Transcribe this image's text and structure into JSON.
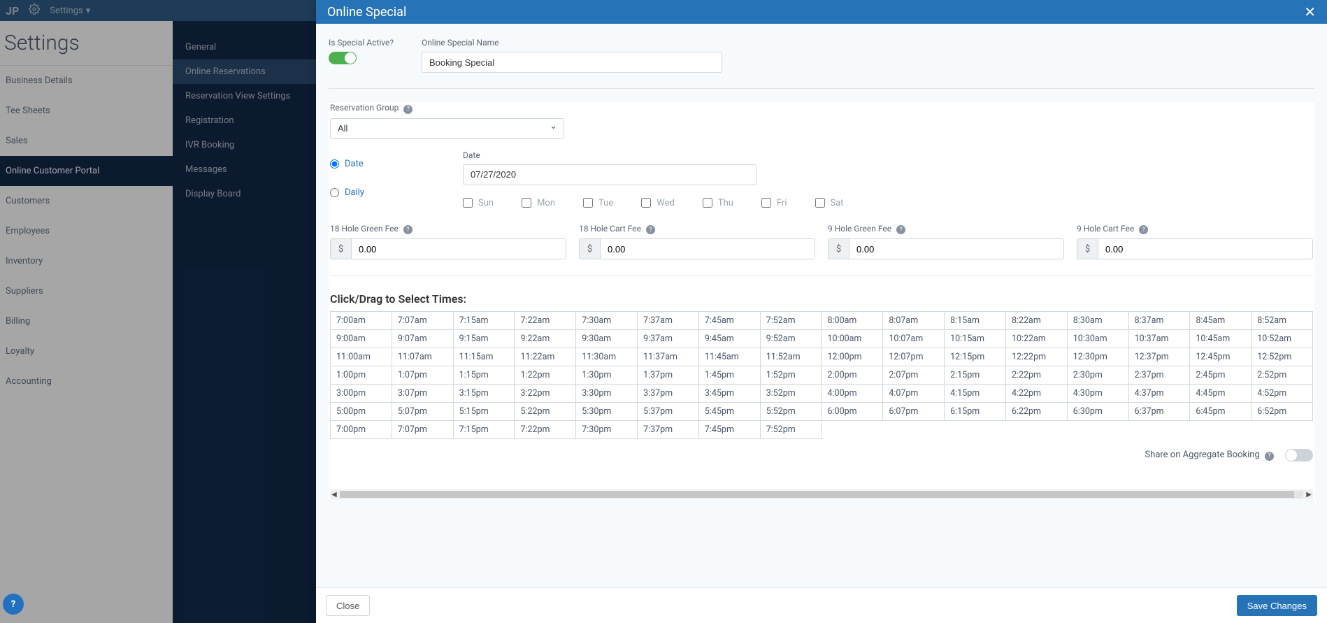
{
  "topbar": {
    "logo": "JP",
    "settings_label": "Settings"
  },
  "page": {
    "title": "Settings"
  },
  "nav1": [
    "Business Details",
    "Tee Sheets",
    "Sales",
    "Online Customer Portal",
    "Customers",
    "Employees",
    "Inventory",
    "Suppliers",
    "Billing",
    "Loyalty",
    "Accounting"
  ],
  "nav1_active": 3,
  "nav2": [
    "General",
    "Online Reservations",
    "Reservation View Settings",
    "Registration",
    "IVR Booking",
    "Messages",
    "Display Board"
  ],
  "nav2_active": 1,
  "modal": {
    "title": "Online Special",
    "is_active_label": "Is Special Active?",
    "name_label": "Online Special Name",
    "name_value": "Booking Special",
    "res_group_label": "Reservation Group",
    "res_group_value": "All",
    "date_radio_label": "Date",
    "date_field_label": "Date",
    "date_value": "07/27/2020",
    "daily_radio_label": "Daily",
    "days": [
      "Sun",
      "Mon",
      "Tue",
      "Wed",
      "Thu",
      "Fri",
      "Sat"
    ],
    "fees": {
      "g18": {
        "label": "18 Hole Green Fee",
        "value": "0.00"
      },
      "c18": {
        "label": "18 Hole Cart Fee",
        "value": "0.00"
      },
      "g9": {
        "label": "9 Hole Green Fee",
        "value": "0.00"
      },
      "c9": {
        "label": "9 Hole Cart Fee",
        "value": "0.00"
      }
    },
    "times_head": "Click/Drag to Select Times:",
    "times": [
      [
        "7:00am",
        "7:07am",
        "7:15am",
        "7:22am",
        "7:30am",
        "7:37am",
        "7:45am",
        "7:52am",
        "8:00am",
        "8:07am",
        "8:15am",
        "8:22am",
        "8:30am",
        "8:37am",
        "8:45am",
        "8:52am"
      ],
      [
        "9:00am",
        "9:07am",
        "9:15am",
        "9:22am",
        "9:30am",
        "9:37am",
        "9:45am",
        "9:52am",
        "10:00am",
        "10:07am",
        "10:15am",
        "10:22am",
        "10:30am",
        "10:37am",
        "10:45am",
        "10:52am"
      ],
      [
        "11:00am",
        "11:07am",
        "11:15am",
        "11:22am",
        "11:30am",
        "11:37am",
        "11:45am",
        "11:52am",
        "12:00pm",
        "12:07pm",
        "12:15pm",
        "12:22pm",
        "12:30pm",
        "12:37pm",
        "12:45pm",
        "12:52pm"
      ],
      [
        "1:00pm",
        "1:07pm",
        "1:15pm",
        "1:22pm",
        "1:30pm",
        "1:37pm",
        "1:45pm",
        "1:52pm",
        "2:00pm",
        "2:07pm",
        "2:15pm",
        "2:22pm",
        "2:30pm",
        "2:37pm",
        "2:45pm",
        "2:52pm"
      ],
      [
        "3:00pm",
        "3:07pm",
        "3:15pm",
        "3:22pm",
        "3:30pm",
        "3:37pm",
        "3:45pm",
        "3:52pm",
        "4:00pm",
        "4:07pm",
        "4:15pm",
        "4:22pm",
        "4:30pm",
        "4:37pm",
        "4:45pm",
        "4:52pm"
      ],
      [
        "5:00pm",
        "5:07pm",
        "5:15pm",
        "5:22pm",
        "5:30pm",
        "5:37pm",
        "5:45pm",
        "5:52pm",
        "6:00pm",
        "6:07pm",
        "6:15pm",
        "6:22pm",
        "6:30pm",
        "6:37pm",
        "6:45pm",
        "6:52pm"
      ],
      [
        "7:00pm",
        "7:07pm",
        "7:15pm",
        "7:22pm",
        "7:30pm",
        "7:37pm",
        "7:45pm",
        "7:52pm",
        "",
        "",
        "",
        "",
        "",
        "",
        "",
        ""
      ]
    ],
    "share_label": "Share on Aggregate Booking",
    "close_label": "Close",
    "save_label": "Save Changes",
    "currency": "$"
  }
}
